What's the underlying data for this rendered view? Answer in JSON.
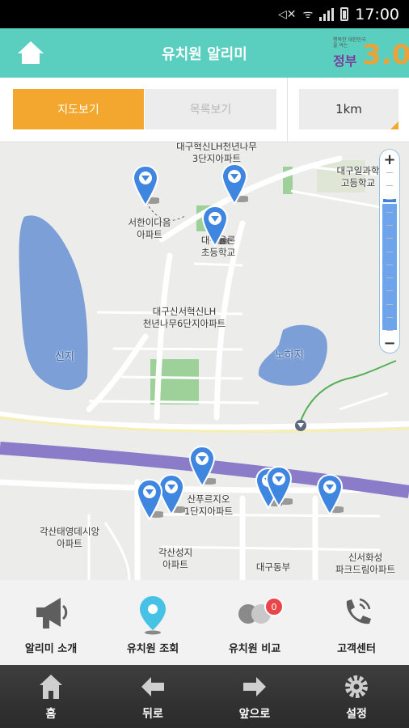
{
  "status": {
    "time": "17:00"
  },
  "header": {
    "title": "유치원 알리미",
    "logo_small": "행복한 대한민국을 여는",
    "logo_big": "정부",
    "logo_num": "3.0"
  },
  "tabs": {
    "map": "지도보기",
    "list": "목록보기",
    "distance": "1km"
  },
  "map": {
    "labels": {
      "apt_top": "대구혁신LH천년나무\n3단지아파트",
      "school_high": "대구일과학\n고등학교",
      "apt_seohan": "서한이다음\n아파트",
      "school_elem": "대구율론\n초등학교",
      "apt_6": "대구신서혁신LH\n천년나무6단지아파트",
      "lake_sinji": "신지",
      "lake_noha": "노하지",
      "apt_sanpuru": "산푸르지오\n1단지아파트",
      "apt_gaksan_yd": "각산태영데시앙\n아파트",
      "apt_gaksan_sj": "각산성지\n아파트",
      "daegu_east": "대구동부",
      "apt_park": "신서화성\n파크드림아파트"
    },
    "pin_color": "#3f86e0",
    "zoom": {
      "plus": "+",
      "minus": "−",
      "level": 0.82
    }
  },
  "bottom_menu": [
    {
      "label": "알리미 소개",
      "icon": "megaphone-icon"
    },
    {
      "label": "유치원 조회",
      "icon": "location-pin-icon"
    },
    {
      "label": "유치원 비교",
      "icon": "compare-icon",
      "badge": "0"
    },
    {
      "label": "고객센터",
      "icon": "phone-icon"
    }
  ],
  "navbar": [
    {
      "label": "홈",
      "icon": "home-icon"
    },
    {
      "label": "뒤로",
      "icon": "back-arrow-icon"
    },
    {
      "label": "앞으로",
      "icon": "forward-arrow-icon"
    },
    {
      "label": "설정",
      "icon": "gear-icon"
    }
  ],
  "colors": {
    "header": "#5acfc0",
    "accent": "#f4a72f",
    "badge": "#e8464a"
  }
}
